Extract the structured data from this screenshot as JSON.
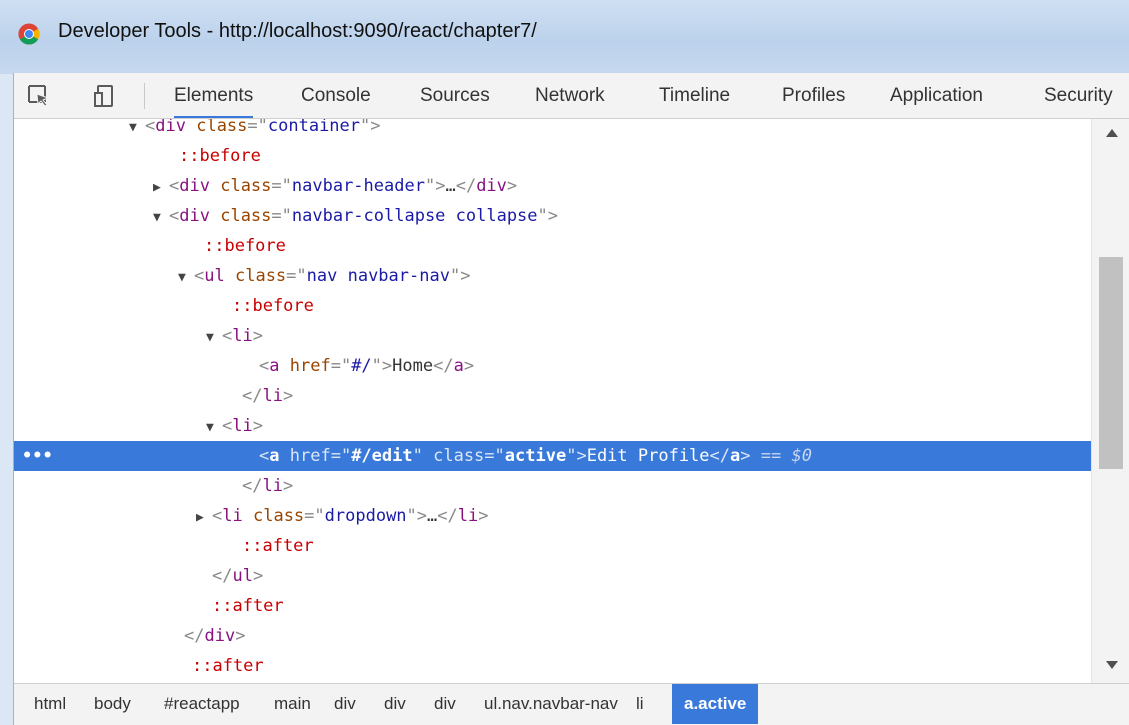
{
  "window": {
    "title": "Developer Tools - http://localhost:9090/react/chapter7/"
  },
  "toolbar": {
    "icons": [
      "inspect-element-icon",
      "device-toolbar-icon"
    ],
    "tabs": [
      "Elements",
      "Console",
      "Sources",
      "Network",
      "Timeline",
      "Profiles",
      "Application",
      "Security"
    ],
    "active_tab": "Elements"
  },
  "dom_tree": {
    "selected_row": 11,
    "selected_marker": "•••",
    "rows": [
      {
        "text": "<div class=\"container\">"
      },
      {
        "text": "::before"
      },
      {
        "text": "<div class=\"navbar-header\">…</div>"
      },
      {
        "text": "<div class=\"navbar-collapse collapse\">"
      },
      {
        "text": "::before"
      },
      {
        "text": "<ul class=\"nav navbar-nav\">"
      },
      {
        "text": "::before"
      },
      {
        "text": "<li>"
      },
      {
        "text": "<a href=\"#/\">Home</a>"
      },
      {
        "text": "</li>"
      },
      {
        "text": "<li>"
      },
      {
        "text": "<a href=\"#/edit\" class=\"active\">Edit Profile</a> == $0"
      },
      {
        "text": "</li>"
      },
      {
        "text": "<li class=\"dropdown\">…</li>"
      },
      {
        "text": "::after"
      },
      {
        "text": "</ul>"
      },
      {
        "text": "::after"
      },
      {
        "text": "</div>"
      },
      {
        "text": "::after"
      }
    ]
  },
  "breadcrumbs": {
    "items": [
      "html",
      "body",
      "#reactapp",
      "main",
      "div",
      "div",
      "div",
      "ul.nav.navbar-nav",
      "li",
      "a.active"
    ],
    "active": "a.active"
  },
  "colors": {
    "selection": "#3879d9",
    "tag": "#881280",
    "attr_name": "#994500",
    "attr_value": "#1a1aa6",
    "pseudo": "#c80000"
  }
}
